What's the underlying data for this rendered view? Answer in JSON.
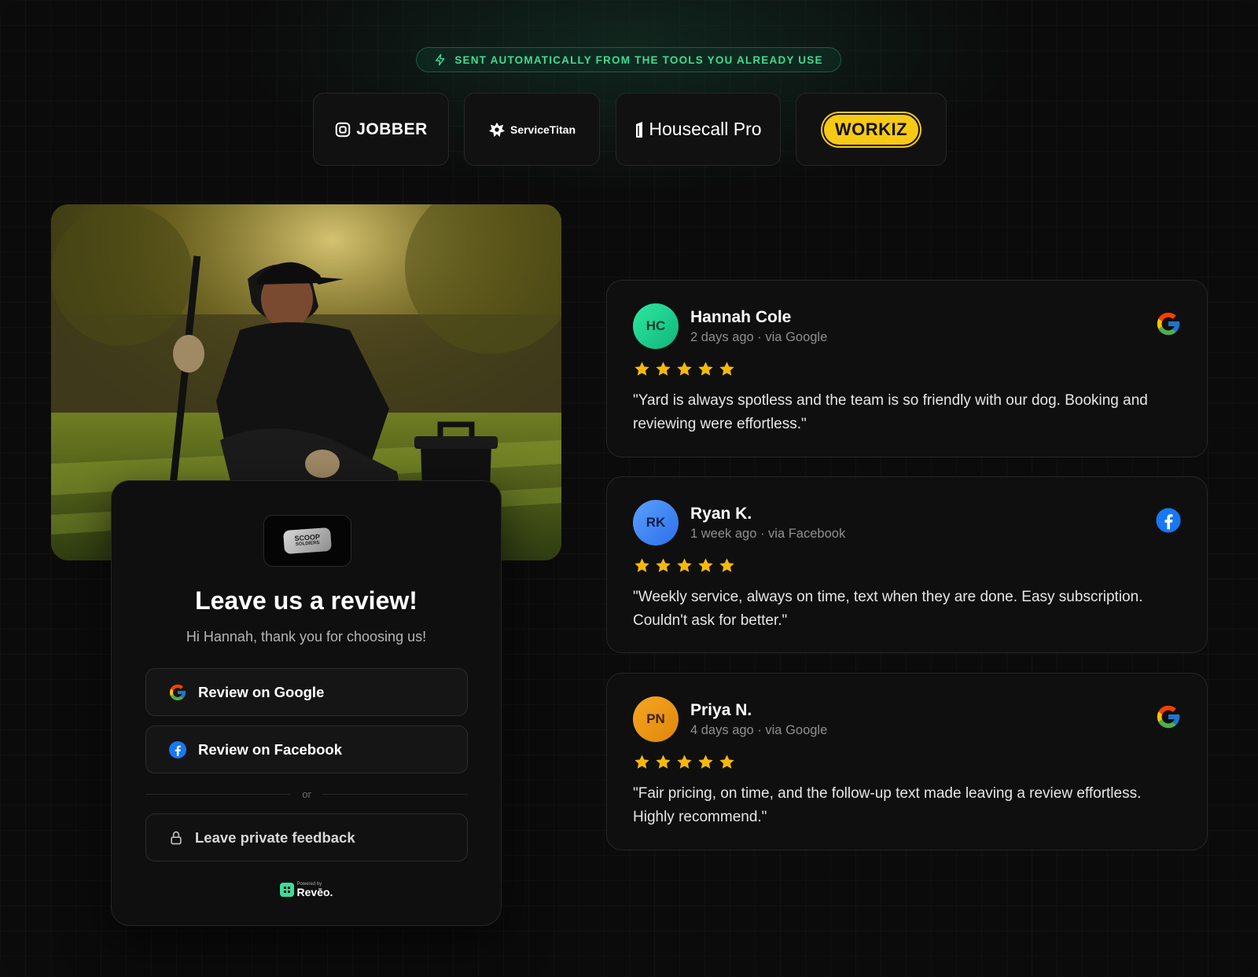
{
  "badge": {
    "text": "SENT AUTOMATICALLY FROM THE TOOLS YOU ALREADY USE",
    "icon": "lightning-icon"
  },
  "integrations": [
    {
      "name": "JOBBER"
    },
    {
      "name": "ServiceTitan"
    },
    {
      "name": "Housecall Pro"
    },
    {
      "name": "WORKIZ"
    }
  ],
  "request_card": {
    "brand_logo_text": [
      "SCOOP",
      "SOLDIERS"
    ],
    "title": "Leave us a review!",
    "subtitle": "Hi Hannah, thank you for choosing us!",
    "google_button": "Review on Google",
    "facebook_button": "Review on Facebook",
    "divider_text": "or",
    "private_button": "Leave private feedback",
    "powered_small": "Powered by",
    "powered_brand": "Revēo."
  },
  "reviews": [
    {
      "initials": "HC",
      "name": "Hannah Cole",
      "meta": "2 days ago · via Google",
      "source": "google",
      "rating": 5,
      "text": "\"Yard is always spotless and the team is so friendly with our dog. Booking and reviewing were effortless.\""
    },
    {
      "initials": "RK",
      "name": "Ryan K.",
      "meta": "1 week ago · via Facebook",
      "source": "facebook",
      "rating": 5,
      "text": "\"Weekly service, always on time, text when they are done. Easy subscription. Couldn't ask for better.\""
    },
    {
      "initials": "PN",
      "name": "Priya N.",
      "meta": "4 days ago · via Google",
      "source": "google",
      "rating": 5,
      "text": "\"Fair pricing, on time, and the follow-up text made leaving a review effortless. Highly recommend.\""
    }
  ],
  "colors": {
    "accent": "#3ddc97",
    "star": "#f5b90a",
    "google_blue": "#4285F4",
    "facebook_blue": "#1877F2"
  }
}
